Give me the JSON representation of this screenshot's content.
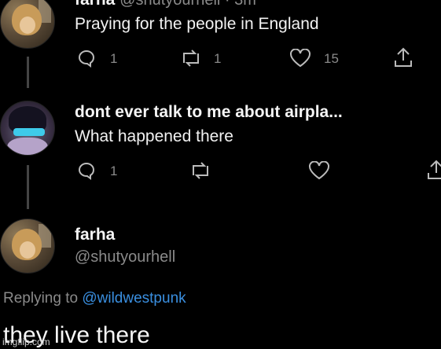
{
  "tweets": [
    {
      "name": "farha",
      "handle_time": "@shutyourhell · 3m",
      "text": "Praying for the people in England",
      "replies": "1",
      "retweets": "1",
      "likes": "15"
    },
    {
      "name": "dont ever talk to me about airpla...",
      "text": "What happened there",
      "replies": "1",
      "retweets": "",
      "likes": ""
    }
  ],
  "main_tweet": {
    "name": "farha",
    "handle": "@shutyourhell",
    "replying_prefix": "Replying to",
    "replying_handle": "@wildwestpunk",
    "text": "they live there"
  },
  "watermark": "imgflip.com",
  "icons": [
    "reply-icon",
    "retweet-icon",
    "like-icon",
    "share-icon"
  ]
}
